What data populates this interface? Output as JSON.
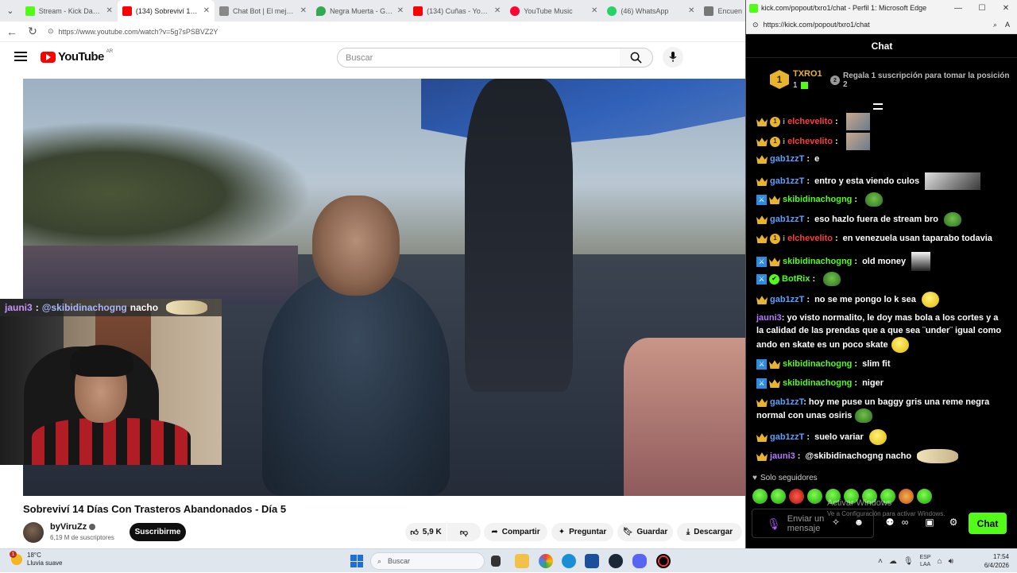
{
  "browser": {
    "tabs": [
      {
        "label": "Stream - Kick Dashboar",
        "icon": "kick-icon",
        "color": "#53fc18"
      },
      {
        "label": "(134) Sobreviví 14 Días C",
        "icon": "youtube-icon",
        "color": "#ff0000",
        "active": true
      },
      {
        "label": "Chat Bot | El mejor softw",
        "icon": "chatbot-icon",
        "color": "#888888"
      },
      {
        "label": "Negra Muerta - Google",
        "icon": "maps-icon",
        "color": "#34a853"
      },
      {
        "label": "(134) Cuñas - YouTube",
        "icon": "youtube-icon",
        "color": "#ff0000"
      },
      {
        "label": "YouTube Music",
        "icon": "youtube-music-icon",
        "color": "#ff0033"
      },
      {
        "label": "(46) WhatsApp",
        "icon": "whatsapp-icon",
        "color": "#25d366"
      },
      {
        "label": "Encuen",
        "icon": "page-icon",
        "color": "#777777"
      }
    ],
    "url": "https://www.youtube.com/watch?v=5g7sPSBVZ2Y"
  },
  "youtube": {
    "logo_text": "YouTube",
    "country": "AR",
    "search_placeholder": "Buscar",
    "video_title": "Sobreviví 14 Días Con Trasteros Abandonados - Día 5",
    "channel_name": "byViruZz",
    "subscribers": "6,19 M de suscriptores",
    "subscribe_label": "Suscribirme",
    "likes": "5,9 K",
    "share_label": "Compartir",
    "ask_label": "Preguntar",
    "save_label": "Guardar",
    "download_label": "Descargar"
  },
  "webcam_overlay": {
    "user": "jauni3",
    "separator": ":",
    "mention": "@skibidinachogng",
    "text": "nacho"
  },
  "kick": {
    "window_title": "kick.com/popout/txro1/chat - Perfil 1: Microsoft Edge",
    "url": "https://kick.com/popout/txro1/chat",
    "chat_title": "Chat",
    "leader": {
      "rank": "1",
      "name": "TXRO1",
      "count": "1"
    },
    "position2": {
      "rank": "2",
      "text": "Regala 1 suscripción para tomar la posición 2"
    },
    "messages": [
      {
        "user": "elchevelito",
        "color": "red",
        "badges": [
          "crown",
          "tier",
          "small"
        ],
        "text": "",
        "emote": "img"
      },
      {
        "user": "elchevelito",
        "color": "red",
        "badges": [
          "crown",
          "tier",
          "small"
        ],
        "text": "",
        "emote": "img"
      },
      {
        "user": "gab1zzT",
        "color": "blue",
        "badges": [
          "crown"
        ],
        "text": "e"
      },
      {
        "user": "gab1zzT",
        "color": "blue",
        "badges": [
          "crown"
        ],
        "text": "entro y esta viendo culos",
        "emote": "wide"
      },
      {
        "user": "skibidinachogng",
        "color": "green",
        "badges": [
          "mod",
          "crown"
        ],
        "text": "",
        "emote": "frog"
      },
      {
        "user": "gab1zzT",
        "color": "blue",
        "badges": [
          "crown"
        ],
        "text": "eso hazlo fuera de stream bro",
        "emote": "frog"
      },
      {
        "user": "elchevelito",
        "color": "red",
        "badges": [
          "crown",
          "tier",
          "small"
        ],
        "text": "en venezuela usan taparabo todavia"
      },
      {
        "user": "skibidinachogng",
        "color": "green",
        "badges": [
          "mod",
          "crown"
        ],
        "text": "old money",
        "emote": "tall"
      },
      {
        "user": "BotRix",
        "color": "green",
        "badges": [
          "mod",
          "verified"
        ],
        "text": "",
        "emote": "frog"
      },
      {
        "user": "gab1zzT",
        "color": "blue",
        "badges": [
          "crown"
        ],
        "text": "no se me pongo lo k sea",
        "emote": "smiley"
      },
      {
        "user": "jauni3",
        "color": "purple",
        "badges": [],
        "text": "yo visto normalito, le doy mas bola a los cortes y a la calidad de las prendas que a que sea ¨under¨ igual como ando en skate es un poco skate",
        "emote": "smiley"
      },
      {
        "user": "skibidinachogng",
        "color": "green",
        "badges": [
          "mod",
          "crown"
        ],
        "text": "slim fit"
      },
      {
        "user": "skibidinachogng",
        "color": "green",
        "badges": [
          "mod",
          "crown"
        ],
        "text": "niger"
      },
      {
        "user": "gab1zzT",
        "color": "blue",
        "badges": [
          "crown"
        ],
        "text": "hoy me puse un baggy gris una reme negra normal con unas osiris",
        "emote": "frog"
      },
      {
        "user": "gab1zzT",
        "color": "blue",
        "badges": [
          "crown"
        ],
        "text": "suelo variar",
        "emote": "smiley"
      },
      {
        "user": "jauni3",
        "color": "purple",
        "badges": [
          "crown"
        ],
        "text": "@skibidinachogng nacho",
        "emote": "cat"
      }
    ],
    "followers_only": "Solo seguidores",
    "input_placeholder": "Enviar un mensaje",
    "send_label": "Chat",
    "watermark_title": "Activar Windows",
    "watermark_sub": "Ve a Configuración para activar Windows."
  },
  "taskbar": {
    "weather_temp": "18°C",
    "weather_desc": "Lluvia suave",
    "alert_count": "1",
    "search_placeholder": "Buscar",
    "lang": "ESP",
    "lang_sub": "LAA",
    "time": "17:54",
    "date": "6/4/2026"
  }
}
